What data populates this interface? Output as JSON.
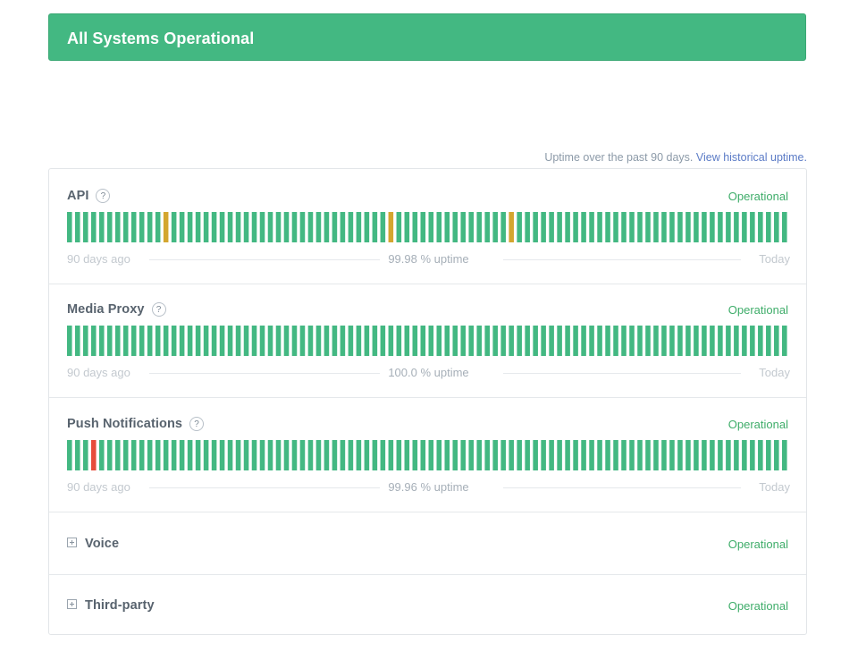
{
  "banner": {
    "title": "All Systems Operational",
    "color": "#43b882"
  },
  "uptime_note": {
    "text": "Uptime over the past 90 days.",
    "link": "View historical uptime."
  },
  "colors": {
    "operational": "#43b882",
    "minor": "#d4a62f",
    "major": "#e74c3c"
  },
  "components": [
    {
      "name": "API",
      "status": "Operational",
      "left_label": "90 days ago",
      "uptime": "99.98 % uptime",
      "right_label": "Today",
      "days": 90,
      "incidents": [
        {
          "day": 12,
          "level": "minor"
        },
        {
          "day": 40,
          "level": "minor"
        },
        {
          "day": 55,
          "level": "minor"
        }
      ]
    },
    {
      "name": "Media Proxy",
      "status": "Operational",
      "left_label": "90 days ago",
      "uptime": "100.0 % uptime",
      "right_label": "Today",
      "days": 90,
      "incidents": []
    },
    {
      "name": "Push Notifications",
      "status": "Operational",
      "left_label": "90 days ago",
      "uptime": "99.96 % uptime",
      "right_label": "Today",
      "days": 90,
      "incidents": [
        {
          "day": 3,
          "level": "major"
        }
      ]
    }
  ],
  "groups": [
    {
      "name": "Voice",
      "status": "Operational"
    },
    {
      "name": "Third-party",
      "status": "Operational"
    }
  ],
  "help_symbol": "?"
}
